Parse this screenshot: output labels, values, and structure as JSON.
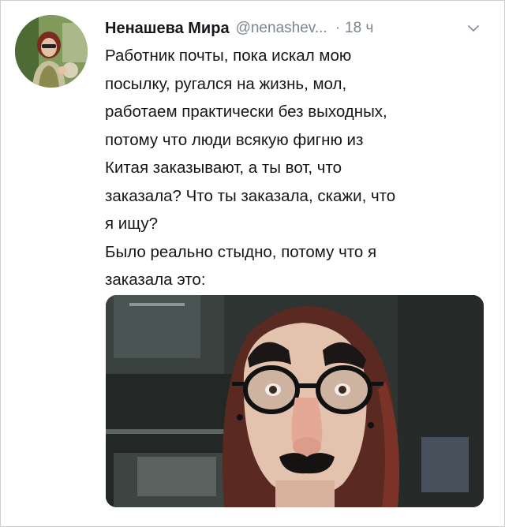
{
  "tweet": {
    "author_name": "Ненашева Мира",
    "author_handle": "@nenashev...",
    "separator": "·",
    "time": "18 ч",
    "text_lines": [
      "Работник почты, пока искал мою",
      "посылку, ругался на жизнь, мол,",
      "работаем практически без выходных,",
      "потому что люди всякую фигню из",
      "Китая заказывают, а ты вот, что",
      "заказала? Что ты заказала, скажи, что",
      "я ищу?",
      "Было реально стыдно, потому что я",
      "заказала это:"
    ]
  },
  "icons": {
    "more": "chevron-down-icon"
  },
  "colors": {
    "text": "#14171a",
    "secondary": "#7a858f"
  }
}
